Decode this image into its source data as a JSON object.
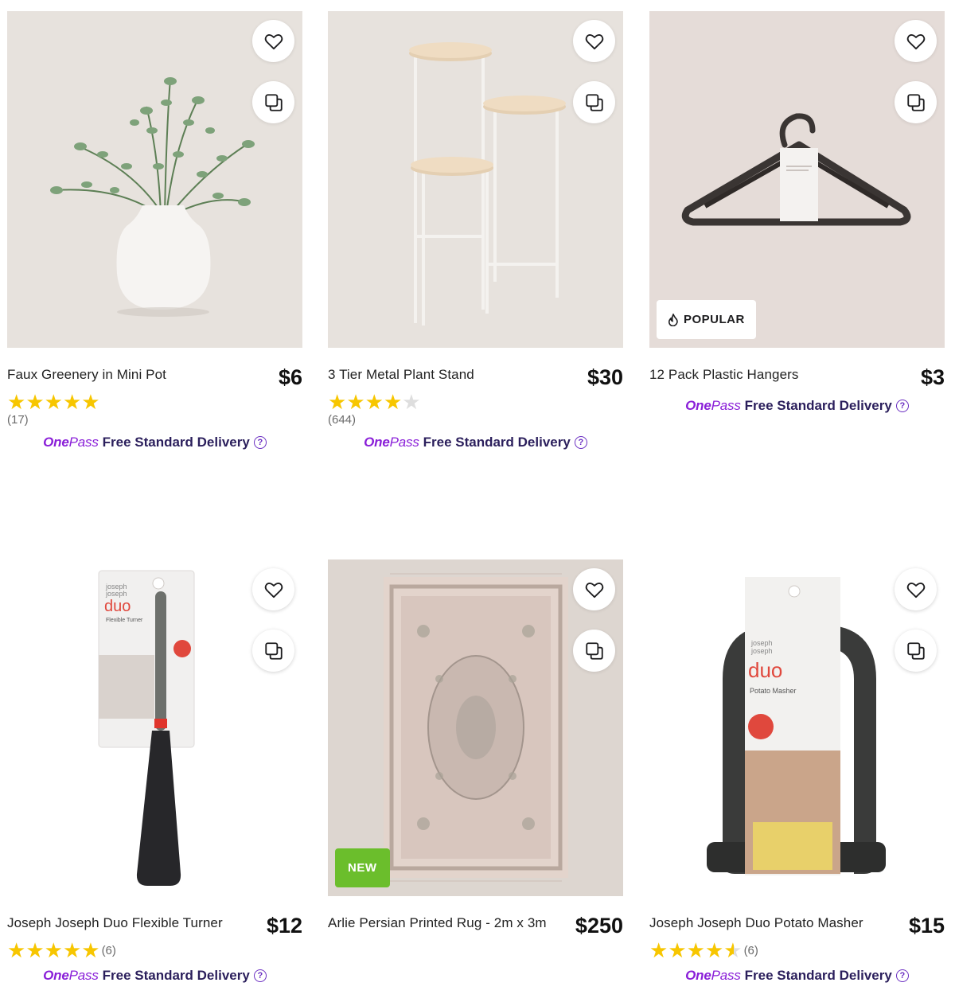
{
  "products": [
    {
      "title": "Faux Greenery in Mini Pot",
      "price": "$6",
      "rating": 5,
      "reviews": "(17)",
      "badge": ""
    },
    {
      "title": "3 Tier Metal Plant Stand",
      "price": "$30",
      "rating": 4,
      "reviews": "(644)",
      "badge": ""
    },
    {
      "title": "12 Pack Plastic Hangers",
      "price": "$3",
      "rating": null,
      "reviews": "",
      "badge": "POPULAR"
    },
    {
      "title": "Joseph Joseph Duo Flexible Turner",
      "price": "$12",
      "rating": 5,
      "reviews": "(6)",
      "badge": ""
    },
    {
      "title": "Arlie Persian Printed Rug - 2m x 3m",
      "price": "$250",
      "rating": null,
      "reviews": "",
      "badge": "NEW"
    },
    {
      "title": "Joseph Joseph Duo Potato Masher",
      "price": "$15",
      "rating": 4.5,
      "reviews": "(6)",
      "badge": ""
    }
  ],
  "delivery": {
    "brand_one": "One",
    "brand_pass": "Pass",
    "label": "Free Standard Delivery",
    "help": "?"
  },
  "packaging": {
    "brand_line1": "joseph",
    "brand_line2": "joseph",
    "duo": "duo",
    "turner_text": "Flexible Turner",
    "masher_text": "Potato Masher"
  },
  "icons": [
    "heart-icon",
    "compare-icon",
    "flame-icon",
    "star-icon",
    "help-icon"
  ],
  "colors": {
    "star": "#f7c600",
    "onepass": "#8a1fd8",
    "new_badge": "#6bbe2c"
  }
}
